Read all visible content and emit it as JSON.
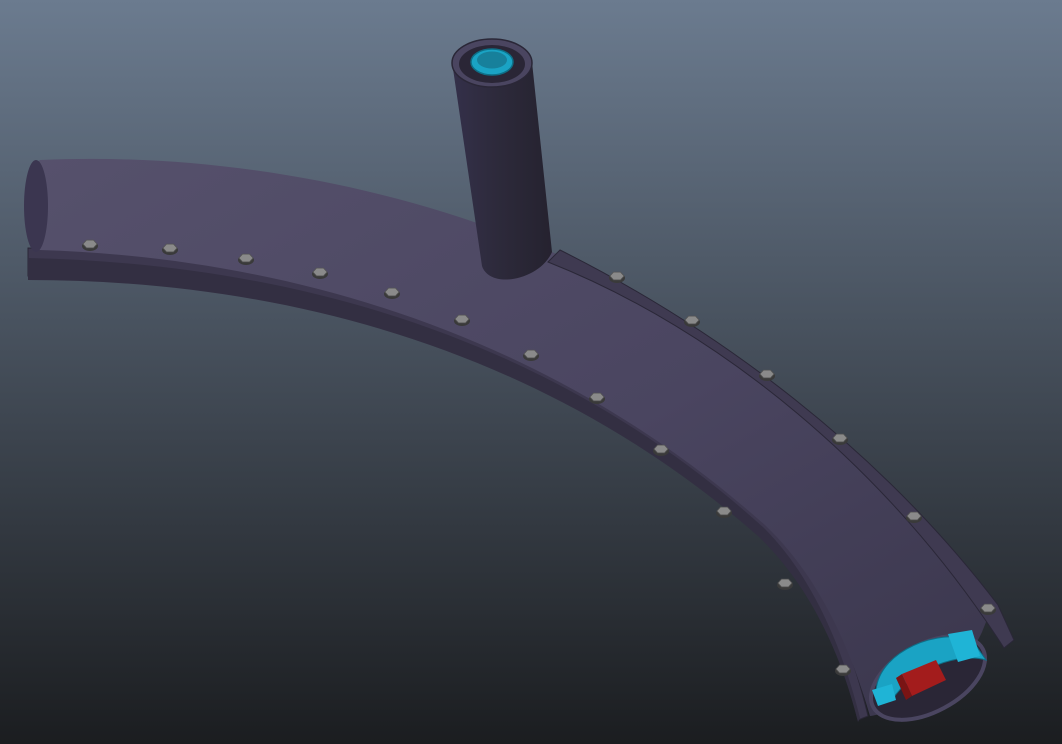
{
  "viewport": {
    "background_top": "#6b7b8f",
    "background_bottom": "#1b1d20"
  },
  "model": {
    "name": "curved-pipe-with-branch",
    "pipe_color": "#4a4560",
    "pipe_highlight": "#57526d",
    "pipe_shadow": "#2f2b3c",
    "flange_color": "#3f3a51",
    "bolt_color": "#8a8a8a",
    "inner_sleeve_color": "#1aa3c4",
    "core_color": "#a31c1c",
    "flange_bolts_outer": 12,
    "flange_bolts_inner": 6
  }
}
